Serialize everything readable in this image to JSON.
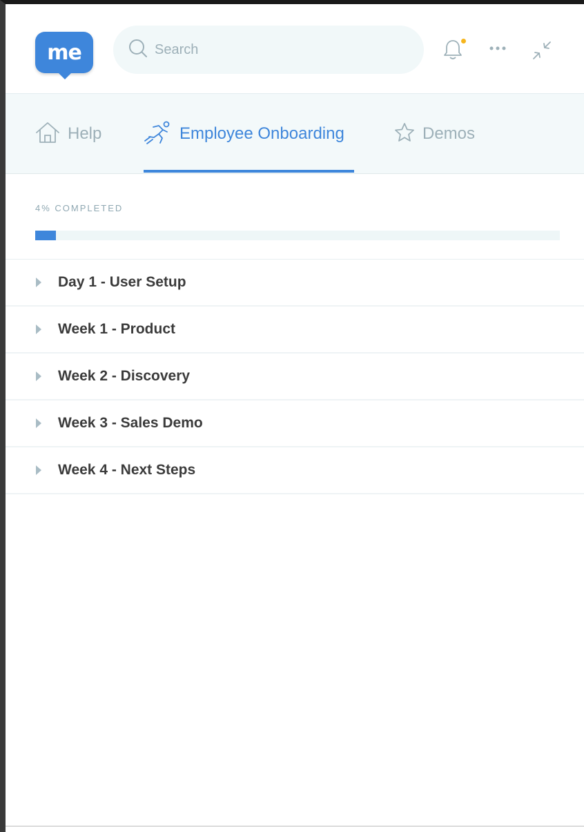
{
  "header": {
    "logo_text": "me",
    "search_placeholder": "Search",
    "notification_dot_color": "#f6b51c"
  },
  "tabs": [
    {
      "label": "Help",
      "icon": "home-icon",
      "active": false
    },
    {
      "label": "Employee Onboarding",
      "icon": "runner-icon",
      "active": true
    },
    {
      "label": "Demos",
      "icon": "star-icon",
      "active": false
    }
  ],
  "progress": {
    "label": "4% COMPLETED",
    "percent": 4
  },
  "sections": [
    {
      "label": "Day 1 - User Setup"
    },
    {
      "label": "Week 1 - Product"
    },
    {
      "label": "Week 2 - Discovery"
    },
    {
      "label": "Week 3 - Sales Demo"
    },
    {
      "label": "Week 4 - Next Steps"
    }
  ],
  "colors": {
    "accent": "#3e86db",
    "muted": "#9db0b8"
  }
}
